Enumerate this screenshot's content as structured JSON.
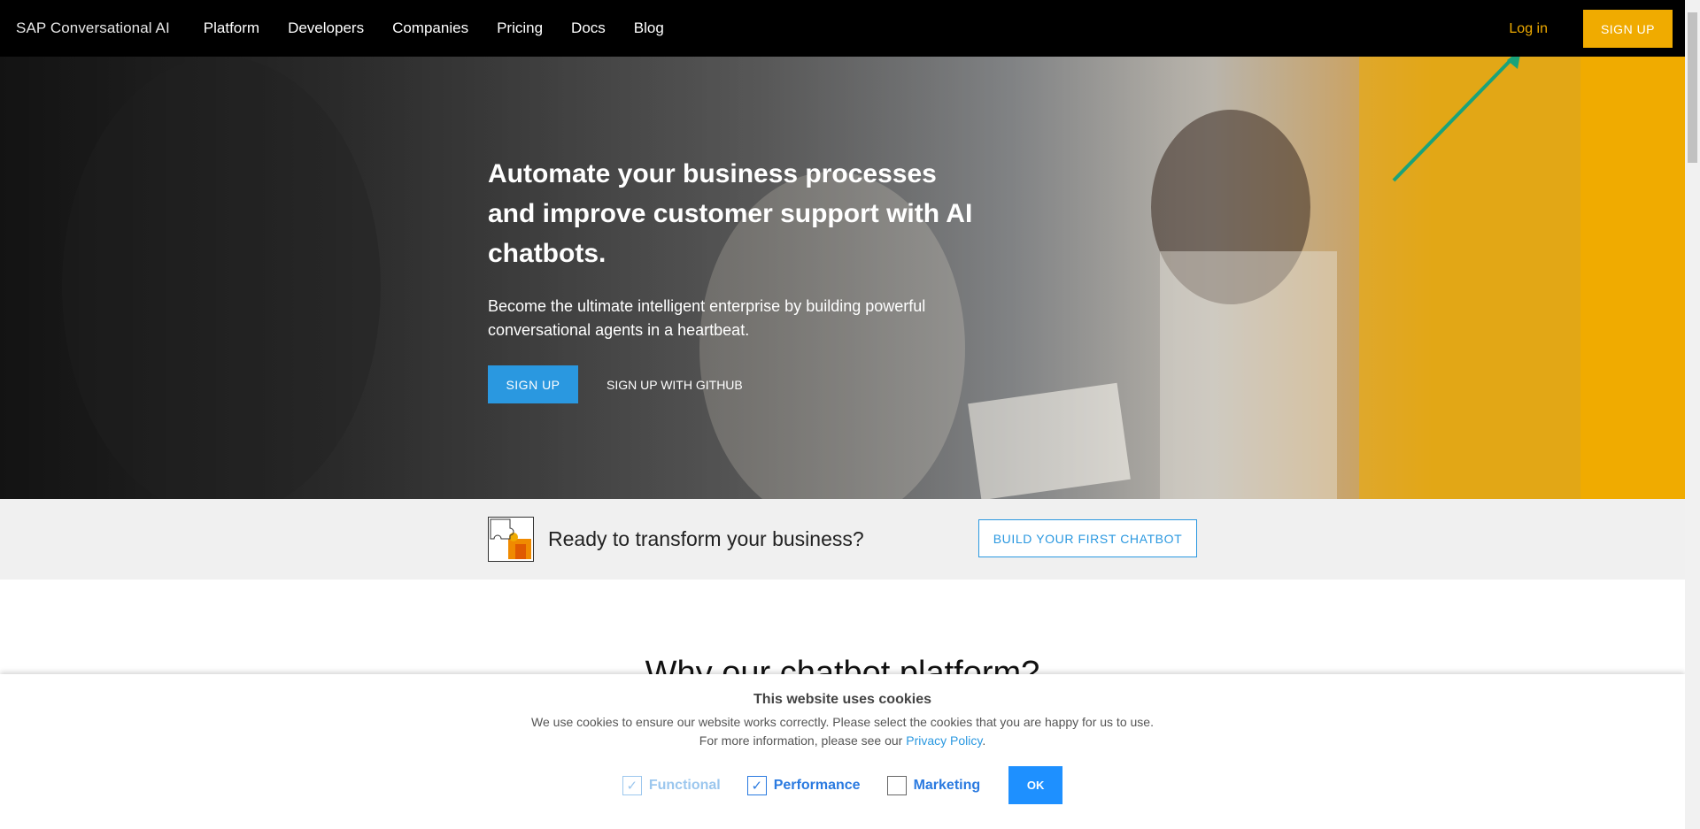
{
  "nav": {
    "brand": "SAP Conversational AI",
    "links": [
      "Platform",
      "Developers",
      "Companies",
      "Pricing",
      "Docs",
      "Blog"
    ],
    "login": "Log in",
    "signup": "SIGN UP"
  },
  "hero": {
    "title": "Automate your business processes and improve customer support with AI chatbots.",
    "subtitle": "Become the ultimate intelligent enterprise by building powerful conversational agents in a heartbeat.",
    "signup": "SIGN UP",
    "github": "SIGN UP WITH GITHUB"
  },
  "cta": {
    "text": "Ready to transform your business?",
    "button": "BUILD YOUR FIRST CHATBOT"
  },
  "section": {
    "title": "Why our chatbot platform?"
  },
  "cookie": {
    "title": "This website uses cookies",
    "line1": "We use cookies to ensure our website works correctly. Please select the cookies that you are happy for us to use.",
    "line2_prefix": "For more information, please see our ",
    "line2_link": "Privacy Policy",
    "line2_suffix": ".",
    "options": [
      {
        "label": "Functional",
        "checked": true,
        "disabled": true
      },
      {
        "label": "Performance",
        "checked": true,
        "disabled": false
      },
      {
        "label": "Marketing",
        "checked": false,
        "disabled": false
      }
    ],
    "ok": "OK"
  },
  "colors": {
    "accent_yellow": "#f0ab00",
    "accent_blue": "#2a98e0",
    "arrow_teal": "#1aa37a"
  }
}
